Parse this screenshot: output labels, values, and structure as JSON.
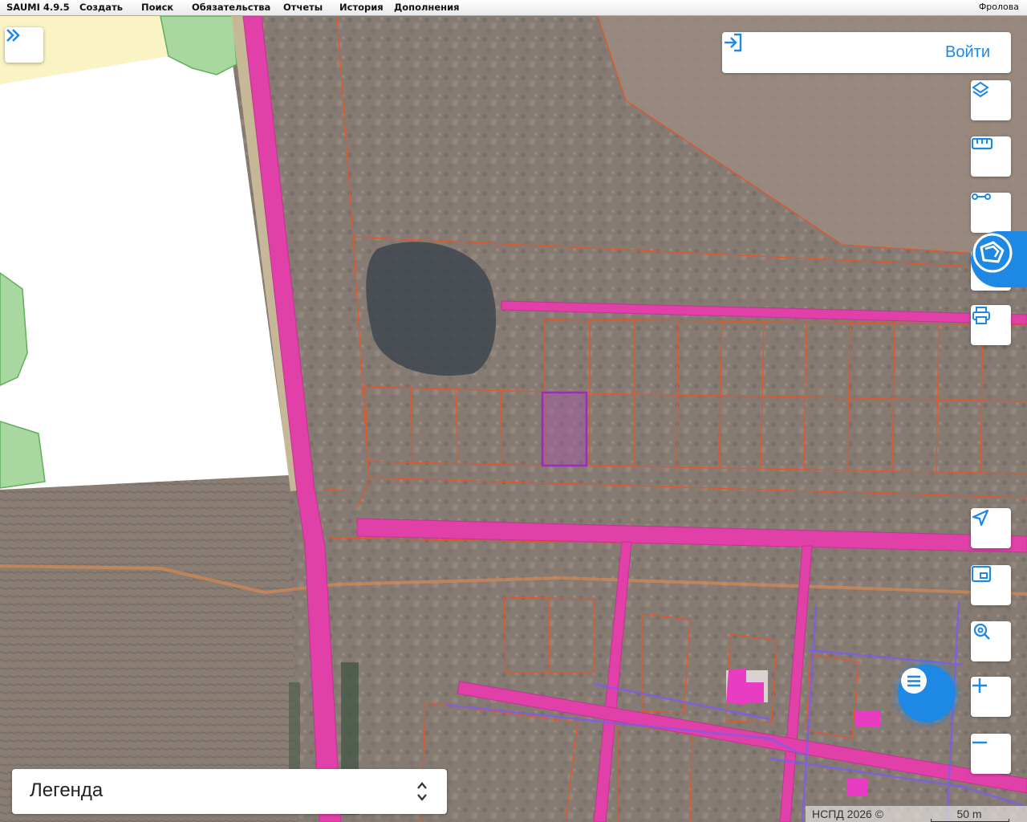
{
  "menu": {
    "app": "SAUMI 4.9.5",
    "items": [
      "Создать",
      "Поиск",
      "Обязательства",
      "Отчеты",
      "История",
      "Дополнения"
    ],
    "user": "Фролова"
  },
  "login": {
    "label": "Войти"
  },
  "toolbar": {
    "top": [
      {
        "name": "layers-icon"
      },
      {
        "name": "ruler-icon"
      },
      {
        "name": "select-area-icon"
      },
      {
        "name": "route-icon"
      },
      {
        "name": "print-icon"
      }
    ],
    "bottom": [
      {
        "name": "locate-icon"
      },
      {
        "name": "minimap-icon"
      },
      {
        "name": "search-location-icon"
      },
      {
        "name": "zoom-in-icon"
      },
      {
        "name": "zoom-out-icon"
      }
    ]
  },
  "legend": {
    "label": "Легенда"
  },
  "attribution": {
    "text": "НСПД 2026 ©",
    "scale": "50 m"
  },
  "colors": {
    "accent": "#1e88e5",
    "parcel_outline": "#e2562a",
    "road_fill": "#e040a8",
    "highlight": "#9b2cbd",
    "green_zone": "#a8d8a0"
  }
}
